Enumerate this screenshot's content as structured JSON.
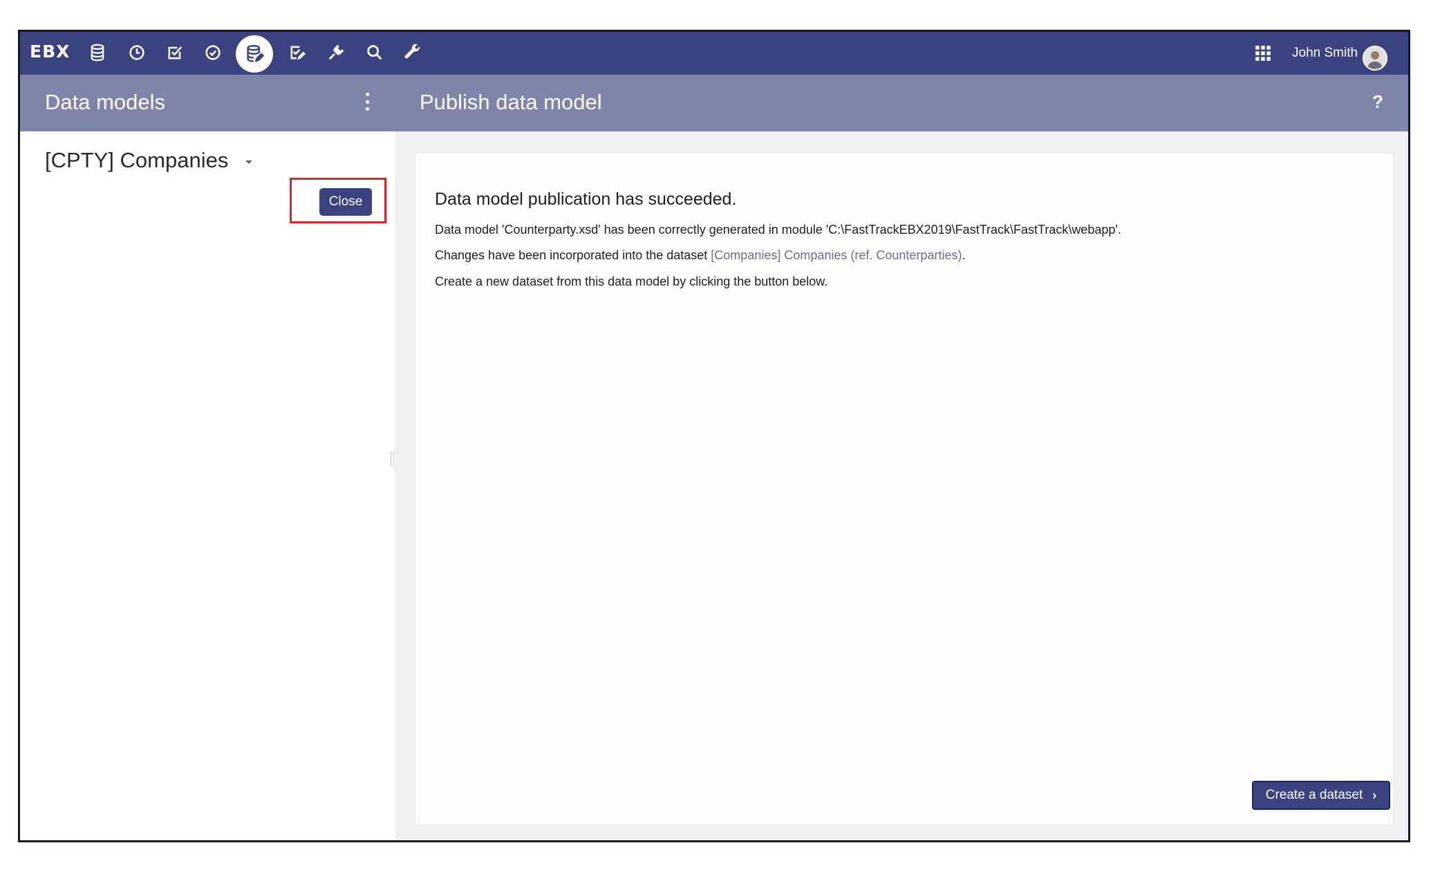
{
  "topbar": {
    "logo": "EBX",
    "nav_icons": [
      "database-icon",
      "clock-icon",
      "checkbox-icon",
      "check-circle-icon",
      "data-model-icon",
      "edit-checklist-icon",
      "plug-icon",
      "search-icon",
      "wrench-icon"
    ],
    "active_icon": "data-model-icon",
    "user_name": "John Smith"
  },
  "subheader": {
    "left_title": "Data models",
    "right_title": "Publish data model",
    "help": "?"
  },
  "left_panel": {
    "model_name": "[CPTY] Companies",
    "close_label": "Close"
  },
  "main": {
    "message_title": "Data model publication has succeeded.",
    "line1": "Data model 'Counterparty.xsd' has been correctly generated in module 'C:\\FastTrackEBX2019\\FastTrack\\FastTrack\\webapp'.",
    "line2_prefix": "Changes have been incorporated into the dataset ",
    "line2_link": "[Companies] Companies (ref. Counterparties)",
    "line2_suffix": ".",
    "line3": "Create a new dataset from this data model by clicking the button below.",
    "create_button": "Create a dataset",
    "create_chevron": "›"
  },
  "colors": {
    "topbar": "#3a4280",
    "subheader": "#7f84aa",
    "highlight": "#e02323",
    "button": "#3a4280"
  }
}
